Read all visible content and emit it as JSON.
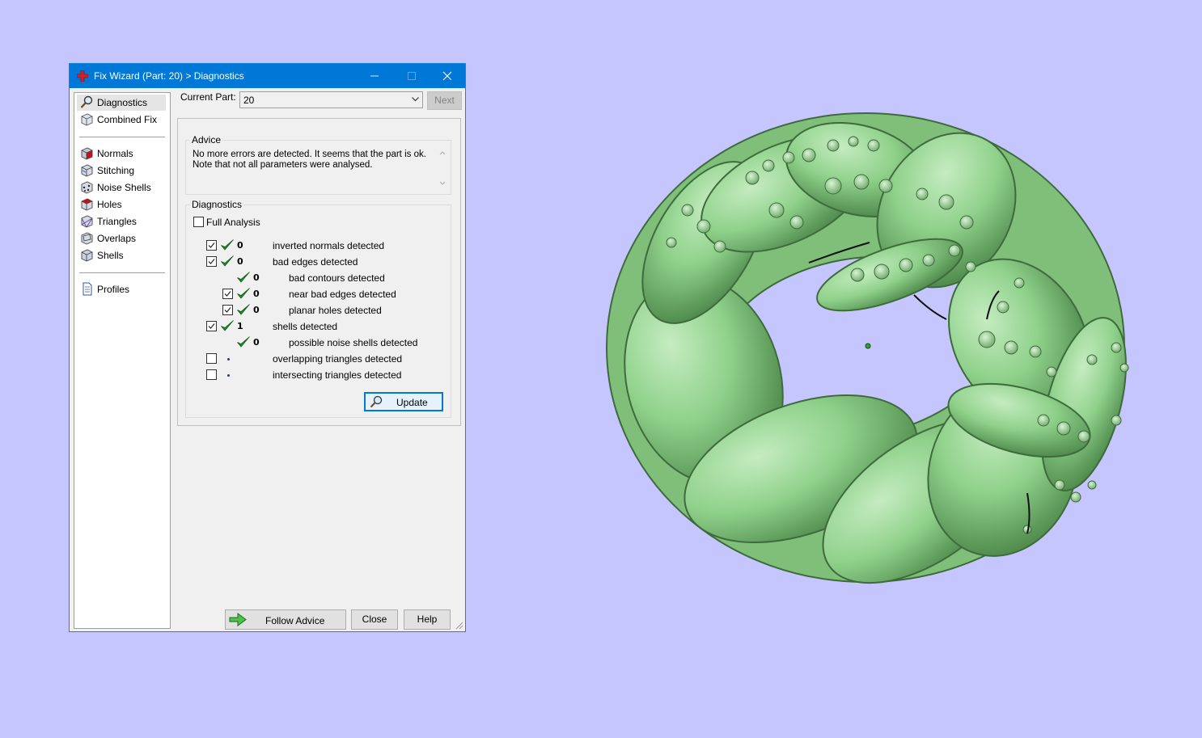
{
  "window": {
    "title": "Fix Wizard (Part: 20) > Diagnostics",
    "controls": {
      "minimize": "minimize",
      "maximize": "maximize",
      "close": "close"
    }
  },
  "sidebar": {
    "items": [
      {
        "label": "Diagnostics",
        "icon": "magnifier-icon",
        "selected": true
      },
      {
        "label": "Combined Fix",
        "icon": "cube-icon"
      },
      {
        "label": "Normals",
        "icon": "normals-cube-icon"
      },
      {
        "label": "Stitching",
        "icon": "stitching-cube-icon"
      },
      {
        "label": "Noise Shells",
        "icon": "noise-shells-icon"
      },
      {
        "label": "Holes",
        "icon": "holes-cube-icon"
      },
      {
        "label": "Triangles",
        "icon": "triangles-icon"
      },
      {
        "label": "Overlaps",
        "icon": "overlaps-icon"
      },
      {
        "label": "Shells",
        "icon": "shells-icon"
      },
      {
        "label": "Profiles",
        "icon": "document-icon"
      }
    ]
  },
  "current_part": {
    "label": "Current Part:",
    "value": "20",
    "next_label": "Next"
  },
  "advice": {
    "title": "Advice",
    "line1": "No more errors are detected. It seems that the part is ok.",
    "line2": "Note that not all parameters were analysed."
  },
  "diagnostics": {
    "title": "Diagnostics",
    "full_analysis_label": "Full Analysis",
    "rows": [
      {
        "count": "0",
        "label": "inverted normals detected",
        "checked": true,
        "status": "ok"
      },
      {
        "count": "0",
        "label": "bad edges detected",
        "checked": true,
        "status": "ok"
      },
      {
        "count": "0",
        "label": "bad contours detected",
        "status": "ok"
      },
      {
        "count": "0",
        "label": "near bad edges detected",
        "checked": true,
        "status": "ok"
      },
      {
        "count": "0",
        "label": "planar holes detected",
        "checked": true,
        "status": "ok"
      },
      {
        "count": "1",
        "label": "shells detected",
        "checked": true,
        "status": "ok"
      },
      {
        "count": "0",
        "label": "possible noise shells detected",
        "status": "ok"
      },
      {
        "count": "",
        "label": "overlapping triangles detected",
        "checked": false,
        "status": "not-analysed"
      },
      {
        "count": "",
        "label": "intersecting triangles detected",
        "checked": false,
        "status": "not-analysed"
      }
    ],
    "update_label": "Update"
  },
  "footer": {
    "follow_advice_label": "Follow Advice",
    "close_label": "Close",
    "help_label": "Help"
  },
  "colors": {
    "background": "#c6c6fe",
    "titlebar": "#0078d7",
    "model_green": "#8fd18b",
    "check_green": "#1f8a2c"
  }
}
